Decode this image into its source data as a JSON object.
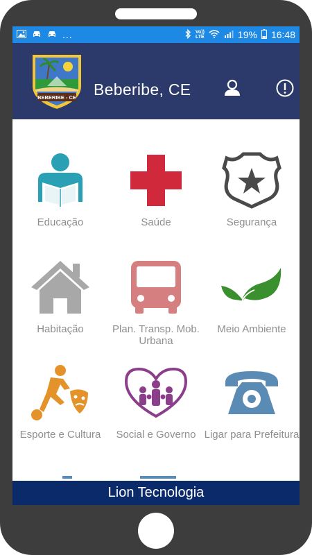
{
  "status_bar": {
    "left_icons": [
      "image-icon",
      "car-icon",
      "car-icon"
    ],
    "overflow": "...",
    "right_icons": [
      "bluetooth-icon",
      "volte-icon",
      "wifi-icon",
      "signal-icon"
    ],
    "volte_top": "Vo))",
    "volte_bottom": "LTE",
    "battery": "19%",
    "time": "16:48",
    "color": "#1e88e5"
  },
  "header": {
    "title": "Beberibe, CE",
    "logo_text": "BEBERIBE - CE",
    "background": "#2b3a6b",
    "actions": [
      "user-icon",
      "info-icon"
    ]
  },
  "menu": [
    {
      "label": "Educação",
      "icon": "reader-icon",
      "color": "#2aa0b5"
    },
    {
      "label": "Saúde",
      "icon": "red-cross-icon",
      "color": "#d0293b"
    },
    {
      "label": "Segurança",
      "icon": "police-badge-icon",
      "color": "#4a4a4a"
    },
    {
      "label": "Habitação",
      "icon": "house-icon",
      "color": "#a8a8a8"
    },
    {
      "label": "Plan. Transp. Mob. Urbana",
      "icon": "bus-icon",
      "color": "#d57f80"
    },
    {
      "label": "Meio Ambiente",
      "icon": "leaves-icon",
      "color": "#3a8f2f"
    },
    {
      "label": "Esporte e Cultura",
      "icon": "sport-culture-icon",
      "color": "#e4922a"
    },
    {
      "label": "Social e Governo",
      "icon": "family-heart-icon",
      "color": "#8b3f8b"
    },
    {
      "label": "Ligar para Prefeitura",
      "icon": "telephone-icon",
      "color": "#5a8bb5"
    }
  ],
  "footer": {
    "text": "Lion Tecnologia",
    "background": "#0b2a6a"
  }
}
